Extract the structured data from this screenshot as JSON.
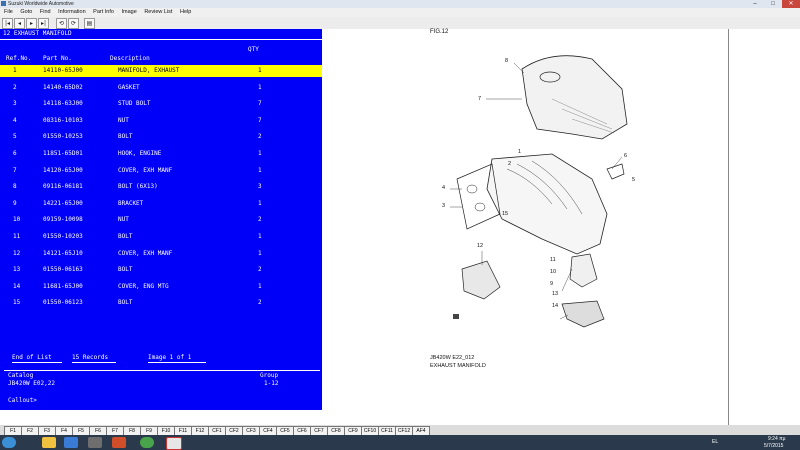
{
  "window": {
    "title": "Suzuki Worldwide Automotive",
    "minimize": "–",
    "maximize": "□",
    "close": "✕"
  },
  "menu": [
    "File",
    "Goto",
    "Find",
    "Information",
    "Part Info",
    "Image",
    "Review List",
    "Help"
  ],
  "toolbar": {
    "buttons": [
      "|◂",
      "◂",
      "▸",
      "▸|",
      "⟲",
      "⟳",
      "▤"
    ]
  },
  "panel": {
    "header": "12  EXHAUST MANIFOLD",
    "columns": {
      "ref": "Ref.No.",
      "part": "Part No.",
      "description": "Description",
      "qty": "QTY"
    },
    "rows": [
      {
        "ref": "1",
        "part": "14110-65J00",
        "desc": "MANIFOLD, EXHAUST",
        "qty": "1"
      },
      {
        "ref": "2",
        "part": "14140-65D02",
        "desc": "GASKET",
        "qty": "1"
      },
      {
        "ref": "3",
        "part": "14118-63J00",
        "desc": "STUD BOLT",
        "qty": "7"
      },
      {
        "ref": "4",
        "part": "08316-10103",
        "desc": "NUT",
        "qty": "7"
      },
      {
        "ref": "5",
        "part": "01550-10253",
        "desc": "BOLT",
        "qty": "2"
      },
      {
        "ref": "6",
        "part": "11851-65D01",
        "desc": "HOOK, ENGINE",
        "qty": "1"
      },
      {
        "ref": "7",
        "part": "14120-65J00",
        "desc": "COVER, EXH MANF",
        "qty": "1"
      },
      {
        "ref": "8",
        "part": "09116-06181",
        "desc": "BOLT (6X13)",
        "qty": "3"
      },
      {
        "ref": "9",
        "part": "14221-65J00",
        "desc": "BRACKET",
        "qty": "1"
      },
      {
        "ref": "10",
        "part": "09159-10098",
        "desc": "NUT",
        "qty": "2"
      },
      {
        "ref": "11",
        "part": "01550-10203",
        "desc": "BOLT",
        "qty": "1"
      },
      {
        "ref": "12",
        "part": "14121-65J10",
        "desc": "COVER, EXH MANF",
        "qty": "1"
      },
      {
        "ref": "13",
        "part": "01550-06163",
        "desc": "BOLT",
        "qty": "2"
      },
      {
        "ref": "14",
        "part": "11681-65J00",
        "desc": "COVER, ENG MTG",
        "qty": "1"
      },
      {
        "ref": "15",
        "part": "01550-06123",
        "desc": "BOLT",
        "qty": "2"
      }
    ],
    "selected_index": 0,
    "status": {
      "end_of_list": "End of List",
      "records": "15 Records",
      "image": "Image 1 of 1"
    },
    "catalog_label": "Catalog",
    "catalog_value": "JB420W E02,22",
    "group_label": "Group",
    "group_value": "1-12",
    "callout_label": "Callout>"
  },
  "diagram": {
    "top_label": "FIG.12",
    "code": "JB420W E22_012",
    "caption": "EXHAUST MANIFOLD",
    "callouts": [
      "8",
      "7",
      "6",
      "5",
      "4",
      "3",
      "2",
      "1",
      "12",
      "11",
      "10",
      "9",
      "13",
      "14",
      "15"
    ]
  },
  "fkeys": [
    "F1",
    "F2",
    "F3",
    "F4",
    "F5",
    "F6",
    "F7",
    "F8",
    "F9",
    "F10",
    "F11",
    "F12",
    "CF1",
    "CF2",
    "CF3",
    "CF4",
    "CF5",
    "CF6",
    "CF7",
    "CF8",
    "CF9",
    "CF10",
    "CF11",
    "CF12",
    "AF4"
  ],
  "tray": {
    "lang": "EL",
    "time": "9:24 πμ",
    "date": "5/7/2015"
  },
  "colors": {
    "panel_bg": "#0000f8",
    "selected_row": "#ffff00",
    "taskbar": "#2a3a4c"
  }
}
